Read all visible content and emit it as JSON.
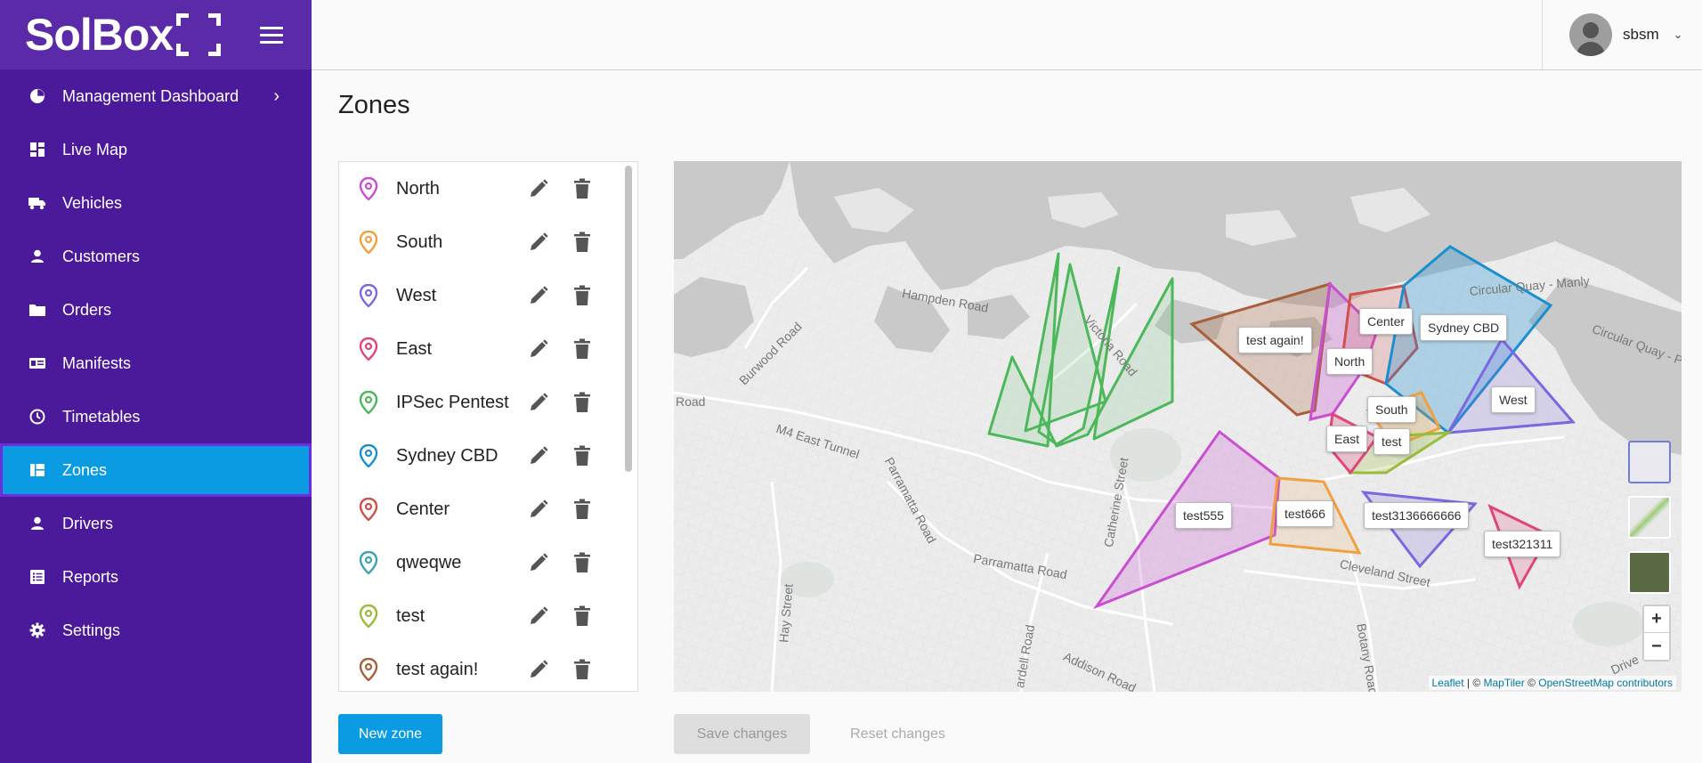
{
  "app": {
    "logo_text": "SolBox"
  },
  "sidebar": {
    "items": [
      {
        "label": "Management Dashboard",
        "icon": "pie-chart-icon"
      },
      {
        "label": "Live Map",
        "icon": "dashboard-icon"
      },
      {
        "label": "Vehicles",
        "icon": "truck-icon"
      },
      {
        "label": "Customers",
        "icon": "person-icon"
      },
      {
        "label": "Orders",
        "icon": "folder-icon"
      },
      {
        "label": "Manifests",
        "icon": "id-card-icon"
      },
      {
        "label": "Timetables",
        "icon": "clock-icon"
      },
      {
        "label": "Zones",
        "icon": "map-grid-icon",
        "active": true
      },
      {
        "label": "Drivers",
        "icon": "person-icon"
      },
      {
        "label": "Reports",
        "icon": "list-icon"
      },
      {
        "label": "Settings",
        "icon": "gear-icon"
      }
    ]
  },
  "header": {
    "username": "sbsm"
  },
  "page": {
    "title": "Zones"
  },
  "zones": [
    {
      "name": "North",
      "color": "#c94fd1"
    },
    {
      "name": "South",
      "color": "#f0a040"
    },
    {
      "name": "West",
      "color": "#7b68e0"
    },
    {
      "name": "East",
      "color": "#e0457b"
    },
    {
      "name": "IPSec Pentest",
      "color": "#4cb85a"
    },
    {
      "name": "Sydney CBD",
      "color": "#1a8fd0"
    },
    {
      "name": "Center",
      "color": "#d0504a"
    },
    {
      "name": "qweqwe",
      "color": "#3aa5b0"
    },
    {
      "name": "test",
      "color": "#9bbb3a"
    },
    {
      "name": "test again!",
      "color": "#a8603a"
    }
  ],
  "buttons": {
    "new_zone": "New zone",
    "save_changes": "Save changes",
    "reset_changes": "Reset changes"
  },
  "map": {
    "labels": {
      "test_again": "test again!",
      "center": "Center",
      "sydney_cbd": "Sydney CBD",
      "north": "North",
      "west": "West",
      "south": "South",
      "east": "East",
      "test": "test",
      "test555": "test555",
      "test666": "test666",
      "test3136666666": "test3136666666",
      "test321311": "test321311"
    },
    "streets": {
      "hampden": "Hampden Road",
      "burwood": "Burwood Road",
      "victoria": "Victoria Road",
      "m4": "M4 East Tunnel",
      "parramatta1": "Parramatta Road",
      "parramatta2": "Parramatta Road",
      "catherine": "Catherine Street",
      "hay": "Hay Street",
      "addison": "Addison Road",
      "cleveland": "Cleveland Street",
      "botany": "Botany Road",
      "circular_manly": "Circular Quay - Manly",
      "circular_p": "Circular Quay - P",
      "road_left": "Road",
      "ardell": "ardell Road",
      "drive": "Drive"
    },
    "zoom_in": "+",
    "zoom_out": "−",
    "attribution": {
      "leaflet": "Leaflet",
      "sep": " | © ",
      "maptiler": "MapTiler",
      "sep2": " © ",
      "osm": "OpenStreetMap contributors"
    }
  }
}
